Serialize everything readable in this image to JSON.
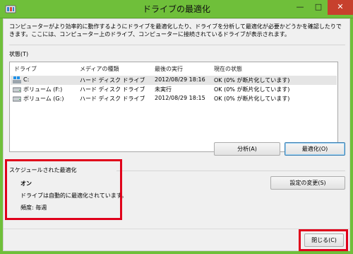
{
  "window": {
    "title": "ドライブの最適化",
    "minimize_glyph": "—",
    "maximize_glyph": "□",
    "close_glyph": "✕",
    "accent": "#6fbf3a"
  },
  "description": "コンピューターがより効率的に動作するようにドライブを最適化したり、ドライブを分析して最適化が必要かどうかを確認したりできます。ここには、コンピューター上のドライブ、コンピューターに接続されているドライブが表示されます。",
  "status": {
    "label": "状態(T)",
    "columns": [
      "ドライブ",
      "メディアの種類",
      "最後の実行",
      "現在の状態"
    ],
    "rows": [
      {
        "drive": "C:",
        "media": "ハード ディスク ドライブ",
        "last_run": "2012/08/29 18:16",
        "state": "OK (0% が断片化しています)",
        "icon": "system-drive-icon"
      },
      {
        "drive": "ボリューム (F:)",
        "media": "ハード ディスク ドライブ",
        "last_run": "未実行",
        "state": "OK (0% が断片化しています)",
        "icon": "hard-drive-icon"
      },
      {
        "drive": "ボリューム (G:)",
        "media": "ハード ディスク ドライブ",
        "last_run": "2012/08/29 18:15",
        "state": "OK (0% が断片化しています)",
        "icon": "hard-drive-icon"
      }
    ],
    "analyze_label": "分析(A)",
    "optimize_label": "最適化(O)"
  },
  "schedule": {
    "label": "スケジュールされた最適化",
    "status": "オン",
    "message": "ドライブは自動的に最適化されています。",
    "frequency": "頻度: 毎週",
    "change_label": "設定の変更(S)"
  },
  "footer": {
    "close_label": "閉じる(C)"
  },
  "highlight_color": "#e0001b"
}
